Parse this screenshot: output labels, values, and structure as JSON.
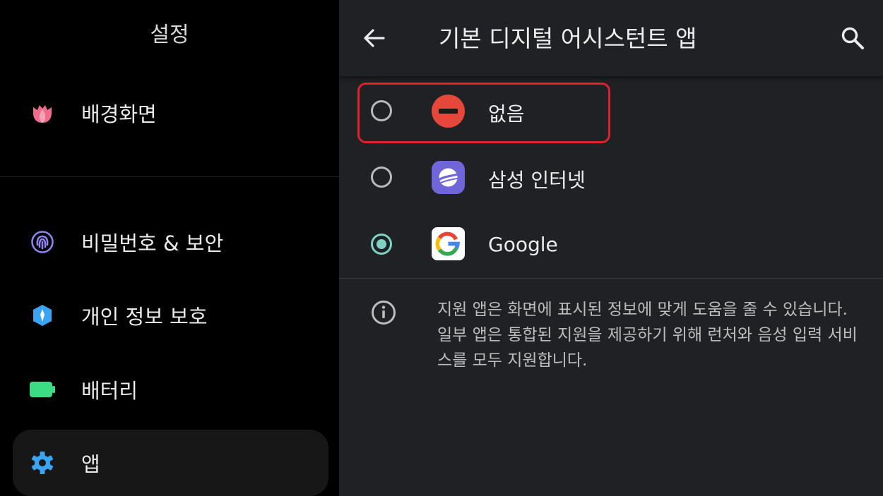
{
  "settings": {
    "title": "설정",
    "items": [
      {
        "label": "배경화면",
        "icon": "flower-icon",
        "color": "#f06b8c"
      },
      {
        "label": "비밀번호 & 보안",
        "icon": "fingerprint-icon",
        "color": "#8e82f0"
      },
      {
        "label": "개인 정보 보호",
        "icon": "privacy-shield-icon",
        "color": "#3aa4f2"
      },
      {
        "label": "배터리",
        "icon": "battery-icon",
        "color": "#3ddc84"
      },
      {
        "label": "앱",
        "icon": "gear-icon",
        "color": "#3aa4f2",
        "selected": true
      }
    ]
  },
  "detail": {
    "title": "기본 디지털 어시스턴트 앱",
    "back_icon": "back-arrow-icon",
    "search_icon": "search-icon",
    "options": [
      {
        "label": "없음",
        "icon": "none-icon",
        "selected": false,
        "highlighted": true
      },
      {
        "label": "삼성 인터넷",
        "icon": "samsung-internet-icon",
        "selected": false
      },
      {
        "label": "Google",
        "icon": "google-icon",
        "selected": true
      }
    ],
    "info_text": "지원 앱은 화면에 표시된 정보에 맞게 도움을 줄 수 있습니다. 일부 앱은 통합된 지원을 제공하기 위해 런처와 음성 입력 서비스를 모두 지원합니다."
  },
  "colors": {
    "accent": "#7cd3c3",
    "highlight_border": "#e0202a",
    "left_bg": "#000000",
    "right_bg": "#202124"
  }
}
